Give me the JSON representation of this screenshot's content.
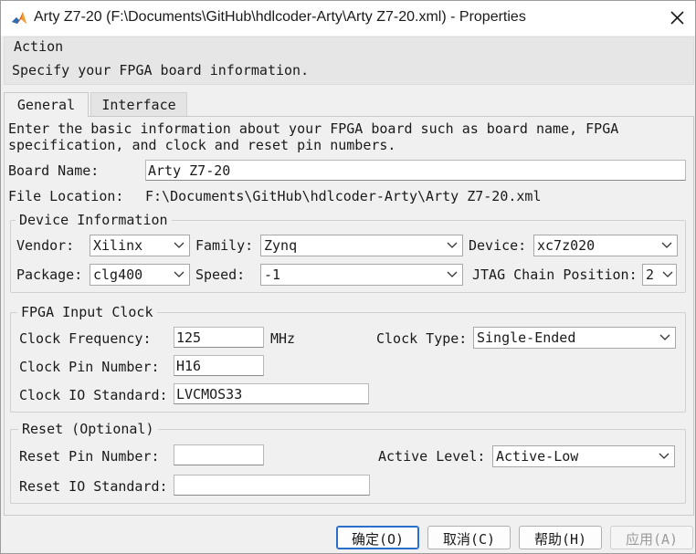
{
  "window": {
    "title": "Arty Z7-20 (F:\\Documents\\GitHub\\hdlcoder-Arty\\Arty Z7-20.xml) - Properties"
  },
  "action": {
    "label": "Action",
    "description": "Specify your FPGA board information."
  },
  "tabs": [
    {
      "label": "General",
      "active": true
    },
    {
      "label": "Interface",
      "active": false
    }
  ],
  "general": {
    "intro_line1": "Enter the basic information about your FPGA board such as board name, FPGA",
    "intro_line2": "specification, and clock and reset pin numbers.",
    "board_name_label": "Board Name:",
    "board_name_value": "Arty Z7-20",
    "file_location_label": "File Location:",
    "file_location_value": "F:\\Documents\\GitHub\\hdlcoder-Arty\\Arty Z7-20.xml"
  },
  "device_info": {
    "legend": "Device Information",
    "vendor_label": "Vendor:",
    "vendor_value": "Xilinx",
    "family_label": "Family:",
    "family_value": "Zynq",
    "device_label": "Device:",
    "device_value": "xc7z020",
    "package_label": "Package:",
    "package_value": "clg400",
    "speed_label": "Speed:",
    "speed_value": "-1",
    "jtag_label": "JTAG Chain Position:",
    "jtag_value": "2"
  },
  "clock": {
    "legend": "FPGA Input Clock",
    "frequency_label": "Clock Frequency:",
    "frequency_value": "125",
    "frequency_unit": "MHz",
    "type_label": "Clock Type:",
    "type_value": "Single-Ended",
    "pin_label": "Clock Pin Number:",
    "pin_value": "H16",
    "io_label": "Clock IO Standard:",
    "io_value": "LVCMOS33"
  },
  "reset": {
    "legend": "Reset (Optional)",
    "pin_label": "Reset Pin Number:",
    "pin_value": "",
    "level_label": "Active Level:",
    "level_value": "Active-Low",
    "io_label": "Reset IO Standard:",
    "io_value": ""
  },
  "buttons": {
    "ok": "确定(O)",
    "cancel": "取消(C)",
    "help": "帮助(H)",
    "apply": "应用(A)"
  },
  "icons": {
    "app": "matlab-icon",
    "close": "close-icon",
    "dropdown": "chevron-down-icon"
  }
}
